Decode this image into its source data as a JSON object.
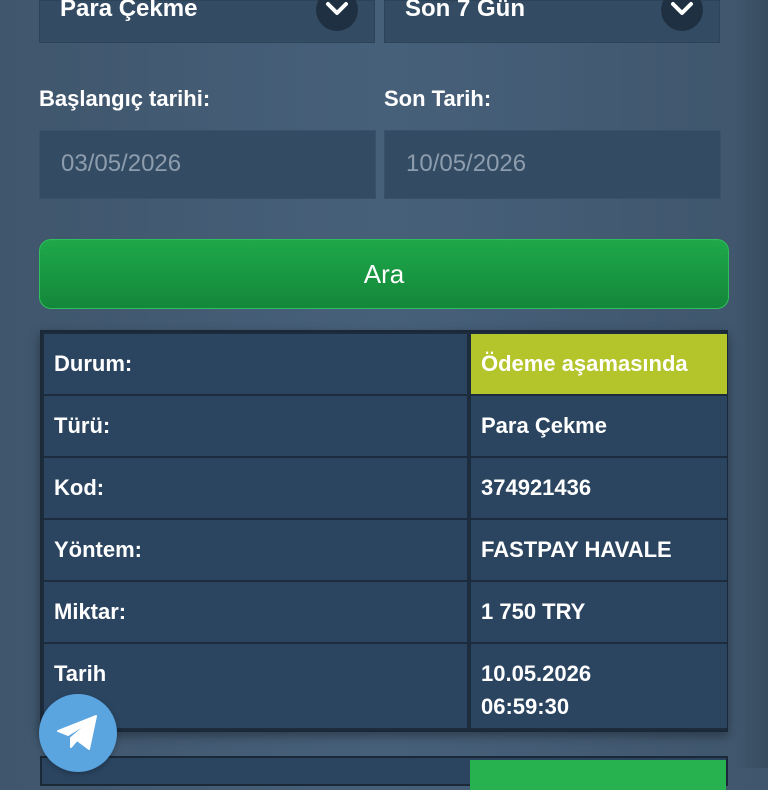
{
  "filters": {
    "type_select": "Para Çekme",
    "period_select": "Son 7 Gün",
    "start_label": "Başlangıç tarihi:",
    "end_label": "Son Tarih:",
    "start_value": "03/05/2026",
    "end_value": "10/05/2026"
  },
  "search_button": "Ara",
  "transaction": {
    "rows": [
      {
        "key": "Durum:",
        "value": "Ödeme aşamasında"
      },
      {
        "key": "Türü:",
        "value": "Para Çekme"
      },
      {
        "key": "Kod:",
        "value": "374921436"
      },
      {
        "key": "Yöntem:",
        "value": "FASTPAY HAVALE"
      },
      {
        "key": "Miktar:",
        "value": "1 750 TRY"
      },
      {
        "key": "Tarih",
        "value_date": "10.05.2026",
        "value_time": "06:59:30"
      }
    ]
  },
  "colors": {
    "status_pending": "#b4c42b",
    "search_green": "#1ea84a",
    "telegram_blue": "#5aa5e0"
  },
  "icons": {
    "chevron": "chevron-down-icon",
    "telegram": "telegram-icon"
  }
}
